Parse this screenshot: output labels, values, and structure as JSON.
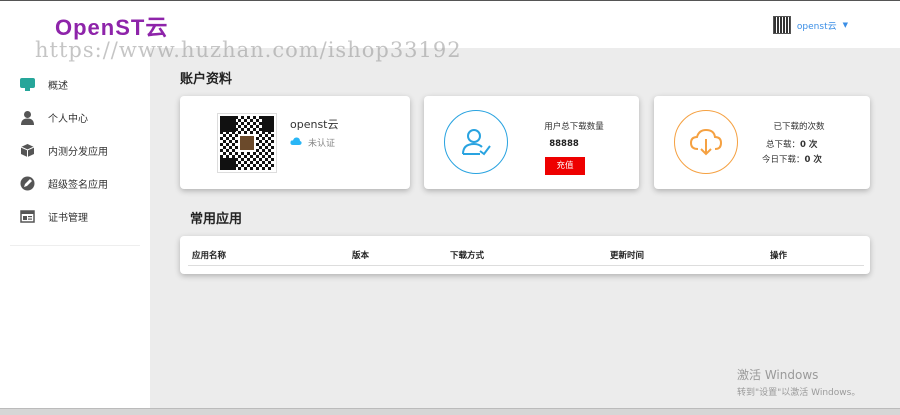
{
  "header": {
    "logo": "OpenST云",
    "watermark": "https://www.huzhan.com/ishop33192",
    "user": {
      "name": "openst云",
      "avatar_icon": "qr-avatar-icon",
      "caret_icon": "caret-down-icon"
    }
  },
  "sidebar": {
    "items": [
      {
        "label": "概述",
        "icon": "monitor-icon",
        "color": "#26a69a"
      },
      {
        "label": "个人中心",
        "icon": "user-icon",
        "color": "#555555"
      },
      {
        "label": "内测分发应用",
        "icon": "box-icon",
        "color": "#555555"
      },
      {
        "label": "超级签名应用",
        "icon": "pen-icon",
        "color": "#555555"
      },
      {
        "label": "证书管理",
        "icon": "certificate-icon",
        "color": "#555555"
      }
    ]
  },
  "account": {
    "title": "账户资料",
    "profile": {
      "name": "openst云",
      "status": "未认证",
      "status_icon": "cloud-icon"
    },
    "downloads": {
      "label": "用户总下载数量",
      "value": "88888",
      "recharge": "充值",
      "icon": "user-check-icon",
      "accent": "#29a3e0"
    },
    "counts": {
      "label": "已下载的次数",
      "total_label": "总下载：",
      "total": "0 次",
      "today_label": "今日下载：",
      "today": "0 次",
      "icon": "cloud-download-icon",
      "accent": "#f5a142"
    }
  },
  "apps": {
    "title": "常用应用",
    "columns": [
      "应用名称",
      "版本",
      "下载方式",
      "更新时间",
      "操作"
    ]
  },
  "os_watermark": {
    "line1": "激活 Windows",
    "line2": "转到\"设置\"以激活 Windows。"
  }
}
